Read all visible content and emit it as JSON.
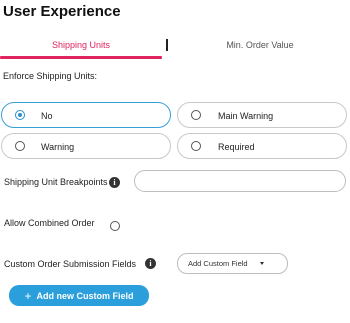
{
  "page_title": "User Experience",
  "tabs": [
    {
      "label": "Shipping Units",
      "active": true
    },
    {
      "label": "Min. Order Value",
      "active": false
    }
  ],
  "enforce_shipping_units": {
    "label": "Enforce Shipping Units:",
    "options": [
      {
        "label": "No",
        "checked": true
      },
      {
        "label": "Main Warning",
        "checked": false
      },
      {
        "label": "Warning",
        "checked": false
      },
      {
        "label": "Required",
        "checked": false
      }
    ]
  },
  "shipping_unit_breakpoints": {
    "label": "Shipping Unit Breakpoints",
    "value": ""
  },
  "allow_combined_order": {
    "label": "Allow Combined Order",
    "checked": false
  },
  "custom_order_submission_fields": {
    "label": "Custom Order Submission Fields",
    "dropdown_value": "Add Custom Field"
  },
  "add_custom_field_button": {
    "label": "Add new Custom Field"
  },
  "icons": {
    "info": "info-icon",
    "plus": "plus-icon",
    "caret": "chevron-down-icon"
  },
  "colors": {
    "accent": "#e0245e",
    "primary": "#2a9fdb",
    "selected_border": "#3a9fd6"
  }
}
